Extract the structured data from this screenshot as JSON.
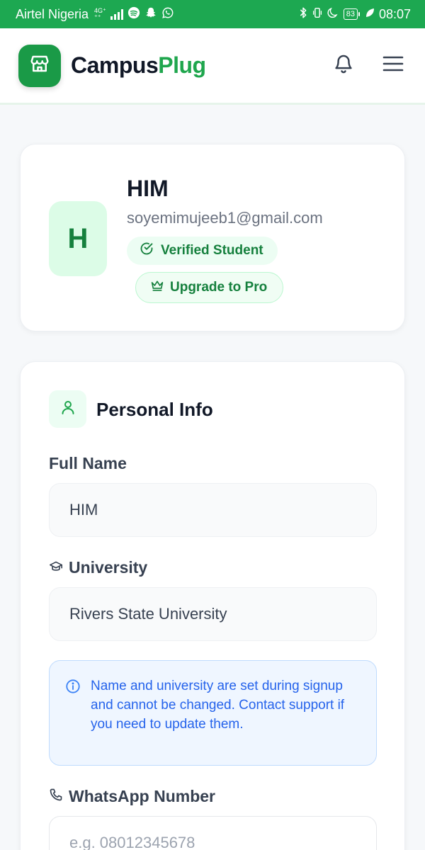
{
  "status_bar": {
    "carrier": "Airtel Nigeria",
    "network_top": "4G⁺",
    "network_bottom": "⁺⁺",
    "battery": "83",
    "time": "08:07"
  },
  "header": {
    "brand_part1": "Campus",
    "brand_part2": "Plug",
    "logo_icon": "store-icon",
    "notification_icon": "bell-icon",
    "menu_icon": "hamburger-menu-icon"
  },
  "profile": {
    "avatar_initial": "H",
    "name": "HIM",
    "email": "soyemimujeeb1@gmail.com",
    "verified_label": "Verified Student",
    "upgrade_label": "Upgrade to Pro"
  },
  "personal_info": {
    "title": "Personal Info",
    "full_name_label": "Full Name",
    "full_name_value": "HIM",
    "university_label": "University",
    "university_value": "Rivers State University",
    "notice": "Name and university are set during signup and cannot be changed. Contact support if you need to update them.",
    "whatsapp_label": "WhatsApp Number",
    "whatsapp_placeholder": "e.g. 08012345678"
  },
  "colors": {
    "brand_green": "#1fa64d",
    "status_bar": "#1da851",
    "notice_blue": "#2563eb"
  }
}
